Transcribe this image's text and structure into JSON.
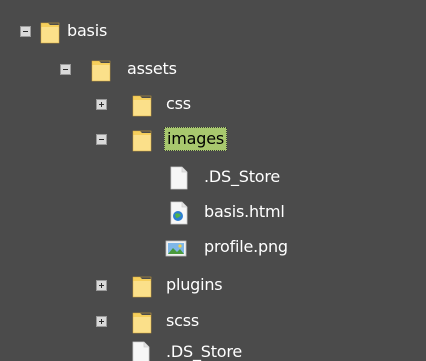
{
  "tree": {
    "items": [
      {
        "label": "basis",
        "toggle": "minus",
        "icon": "folder-icon"
      },
      {
        "label": "assets",
        "toggle": "minus",
        "icon": "folder-icon"
      },
      {
        "label": "css",
        "toggle": "plus",
        "icon": "folder-icon"
      },
      {
        "label": "images",
        "toggle": "minus",
        "icon": "folder-icon",
        "selected": true
      },
      {
        "label": ".DS_Store",
        "icon": "file-icon"
      },
      {
        "label": "basis.html",
        "icon": "html-file-icon"
      },
      {
        "label": "profile.png",
        "icon": "image-file-icon"
      },
      {
        "label": "plugins",
        "toggle": "plus",
        "icon": "folder-icon"
      },
      {
        "label": "scss",
        "toggle": "plus",
        "icon": "folder-icon"
      },
      {
        "label": ".DS_Store",
        "icon": "file-icon"
      }
    ]
  },
  "colors": {
    "background": "#4b4b4b",
    "folder": "#f6cf5c",
    "selection": "#a8c86e",
    "text": "#ffffff"
  }
}
